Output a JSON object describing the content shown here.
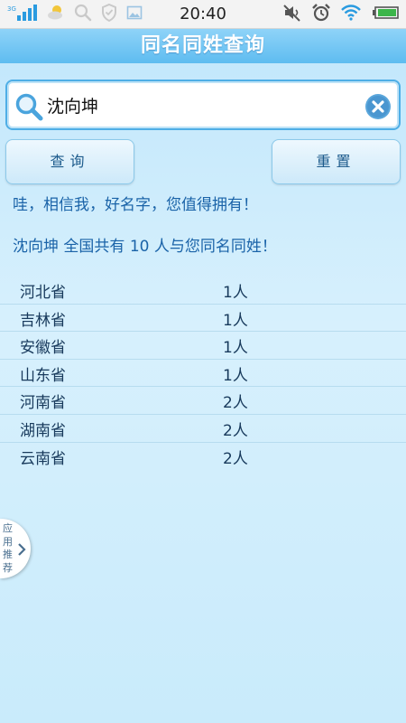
{
  "status_bar": {
    "network_label": "3G",
    "time": "20:40",
    "icons": [
      "signal-icon",
      "weather-icon",
      "search-icon",
      "shield-icon",
      "gallery-icon",
      "mute-icon",
      "alarm-icon",
      "wifi-icon",
      "battery-icon"
    ]
  },
  "header": {
    "title": "同名同姓查询"
  },
  "search": {
    "value": "沈向坤",
    "placeholder": ""
  },
  "buttons": {
    "query_label": "查询",
    "reset_label": "重置"
  },
  "messages": {
    "slogan": "哇，相信我，好名字，您值得拥有！",
    "result_name": "沈向坤",
    "result_prefix": " 全国共有 ",
    "result_count": "10",
    "result_suffix": " 人与您同名同姓！"
  },
  "results": [
    {
      "province": "河北省",
      "count": "1人"
    },
    {
      "province": "吉林省",
      "count": "1人"
    },
    {
      "province": "安徽省",
      "count": "1人"
    },
    {
      "province": "山东省",
      "count": "1人"
    },
    {
      "province": "河南省",
      "count": "2人"
    },
    {
      "province": "湖南省",
      "count": "2人"
    },
    {
      "province": "云南省",
      "count": "2人"
    }
  ],
  "side_tab": {
    "label": "应用推荐"
  },
  "colors": {
    "accent": "#5ebcf0",
    "text_blue": "#1a63a8",
    "background": "#d7f0fd"
  }
}
